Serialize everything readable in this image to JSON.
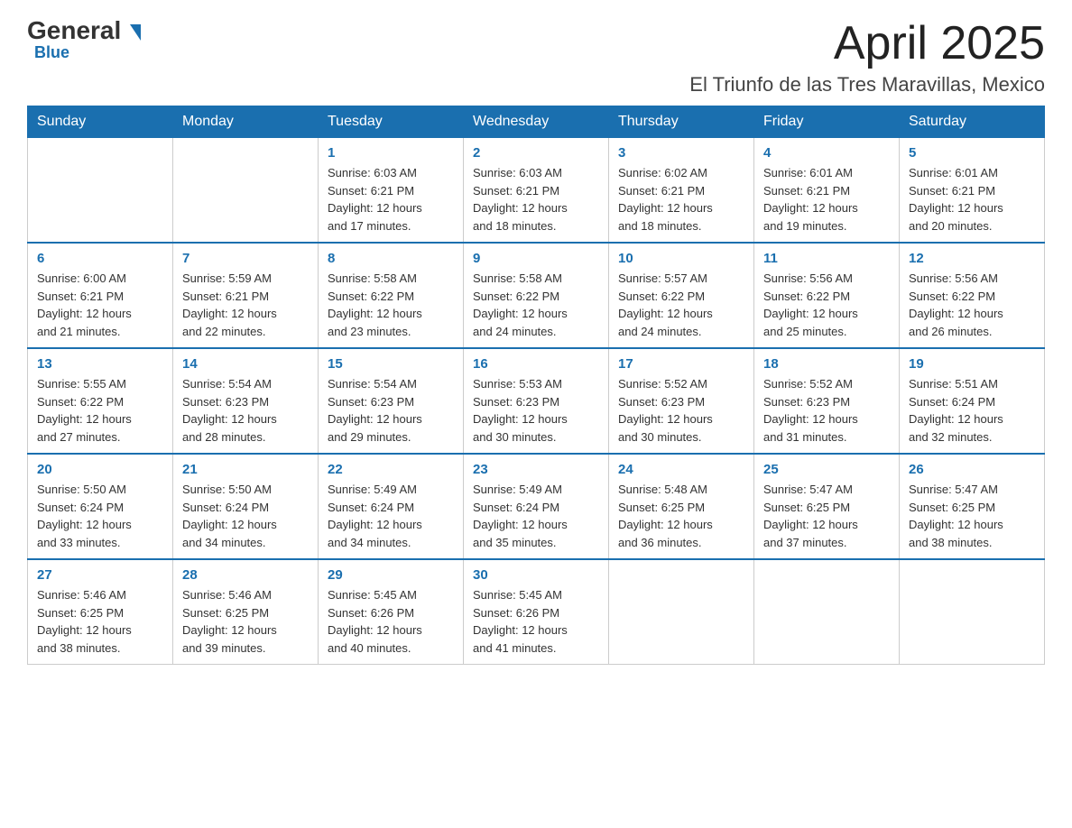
{
  "header": {
    "logo_general": "General",
    "logo_arrow": "▶",
    "logo_blue": "Blue",
    "month_title": "April 2025",
    "location": "El Triunfo de las Tres Maravillas, Mexico"
  },
  "weekdays": [
    "Sunday",
    "Monday",
    "Tuesday",
    "Wednesday",
    "Thursday",
    "Friday",
    "Saturday"
  ],
  "weeks": [
    [
      {
        "day": "",
        "info": ""
      },
      {
        "day": "",
        "info": ""
      },
      {
        "day": "1",
        "info": "Sunrise: 6:03 AM\nSunset: 6:21 PM\nDaylight: 12 hours\nand 17 minutes."
      },
      {
        "day": "2",
        "info": "Sunrise: 6:03 AM\nSunset: 6:21 PM\nDaylight: 12 hours\nand 18 minutes."
      },
      {
        "day": "3",
        "info": "Sunrise: 6:02 AM\nSunset: 6:21 PM\nDaylight: 12 hours\nand 18 minutes."
      },
      {
        "day": "4",
        "info": "Sunrise: 6:01 AM\nSunset: 6:21 PM\nDaylight: 12 hours\nand 19 minutes."
      },
      {
        "day": "5",
        "info": "Sunrise: 6:01 AM\nSunset: 6:21 PM\nDaylight: 12 hours\nand 20 minutes."
      }
    ],
    [
      {
        "day": "6",
        "info": "Sunrise: 6:00 AM\nSunset: 6:21 PM\nDaylight: 12 hours\nand 21 minutes."
      },
      {
        "day": "7",
        "info": "Sunrise: 5:59 AM\nSunset: 6:21 PM\nDaylight: 12 hours\nand 22 minutes."
      },
      {
        "day": "8",
        "info": "Sunrise: 5:58 AM\nSunset: 6:22 PM\nDaylight: 12 hours\nand 23 minutes."
      },
      {
        "day": "9",
        "info": "Sunrise: 5:58 AM\nSunset: 6:22 PM\nDaylight: 12 hours\nand 24 minutes."
      },
      {
        "day": "10",
        "info": "Sunrise: 5:57 AM\nSunset: 6:22 PM\nDaylight: 12 hours\nand 24 minutes."
      },
      {
        "day": "11",
        "info": "Sunrise: 5:56 AM\nSunset: 6:22 PM\nDaylight: 12 hours\nand 25 minutes."
      },
      {
        "day": "12",
        "info": "Sunrise: 5:56 AM\nSunset: 6:22 PM\nDaylight: 12 hours\nand 26 minutes."
      }
    ],
    [
      {
        "day": "13",
        "info": "Sunrise: 5:55 AM\nSunset: 6:22 PM\nDaylight: 12 hours\nand 27 minutes."
      },
      {
        "day": "14",
        "info": "Sunrise: 5:54 AM\nSunset: 6:23 PM\nDaylight: 12 hours\nand 28 minutes."
      },
      {
        "day": "15",
        "info": "Sunrise: 5:54 AM\nSunset: 6:23 PM\nDaylight: 12 hours\nand 29 minutes."
      },
      {
        "day": "16",
        "info": "Sunrise: 5:53 AM\nSunset: 6:23 PM\nDaylight: 12 hours\nand 30 minutes."
      },
      {
        "day": "17",
        "info": "Sunrise: 5:52 AM\nSunset: 6:23 PM\nDaylight: 12 hours\nand 30 minutes."
      },
      {
        "day": "18",
        "info": "Sunrise: 5:52 AM\nSunset: 6:23 PM\nDaylight: 12 hours\nand 31 minutes."
      },
      {
        "day": "19",
        "info": "Sunrise: 5:51 AM\nSunset: 6:24 PM\nDaylight: 12 hours\nand 32 minutes."
      }
    ],
    [
      {
        "day": "20",
        "info": "Sunrise: 5:50 AM\nSunset: 6:24 PM\nDaylight: 12 hours\nand 33 minutes."
      },
      {
        "day": "21",
        "info": "Sunrise: 5:50 AM\nSunset: 6:24 PM\nDaylight: 12 hours\nand 34 minutes."
      },
      {
        "day": "22",
        "info": "Sunrise: 5:49 AM\nSunset: 6:24 PM\nDaylight: 12 hours\nand 34 minutes."
      },
      {
        "day": "23",
        "info": "Sunrise: 5:49 AM\nSunset: 6:24 PM\nDaylight: 12 hours\nand 35 minutes."
      },
      {
        "day": "24",
        "info": "Sunrise: 5:48 AM\nSunset: 6:25 PM\nDaylight: 12 hours\nand 36 minutes."
      },
      {
        "day": "25",
        "info": "Sunrise: 5:47 AM\nSunset: 6:25 PM\nDaylight: 12 hours\nand 37 minutes."
      },
      {
        "day": "26",
        "info": "Sunrise: 5:47 AM\nSunset: 6:25 PM\nDaylight: 12 hours\nand 38 minutes."
      }
    ],
    [
      {
        "day": "27",
        "info": "Sunrise: 5:46 AM\nSunset: 6:25 PM\nDaylight: 12 hours\nand 38 minutes."
      },
      {
        "day": "28",
        "info": "Sunrise: 5:46 AM\nSunset: 6:25 PM\nDaylight: 12 hours\nand 39 minutes."
      },
      {
        "day": "29",
        "info": "Sunrise: 5:45 AM\nSunset: 6:26 PM\nDaylight: 12 hours\nand 40 minutes."
      },
      {
        "day": "30",
        "info": "Sunrise: 5:45 AM\nSunset: 6:26 PM\nDaylight: 12 hours\nand 41 minutes."
      },
      {
        "day": "",
        "info": ""
      },
      {
        "day": "",
        "info": ""
      },
      {
        "day": "",
        "info": ""
      }
    ]
  ]
}
